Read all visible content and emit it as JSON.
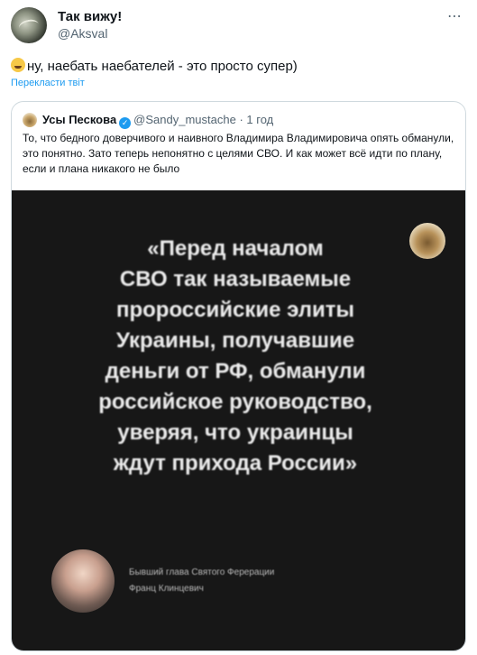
{
  "tweet": {
    "author_name": "Так вижу!",
    "author_handle": "@Aksval",
    "more_icon": "⋯",
    "text": "ну, наебать наебателей - это просто супер)",
    "emoji": "😂",
    "translate_label": "Перекласти твіт"
  },
  "quote": {
    "author_name": "Усы Пескова",
    "verified_icon": "✓",
    "author_handle": "@Sandy_mustache",
    "separator": "·",
    "time": "1 год",
    "text": "То, что бедного доверчивого и наивного Владимира Владимировича опять обманули, это понятно. Зато теперь непонятно с целями СВО. И как может всё идти по плану, если и плана никакого не было",
    "media": {
      "quote_lines": [
        "«Перед началом",
        "СВО так называемые",
        "пророссийские элиты",
        "Украины, получавшие",
        "деньги от РФ, обманули",
        "российское руководство,",
        "уверяя, что украинцы",
        "ждут прихода России»"
      ],
      "speaker_caption": [
        "Бывший глава Святого Ферерации",
        "Франц Клинцевич"
      ]
    }
  }
}
